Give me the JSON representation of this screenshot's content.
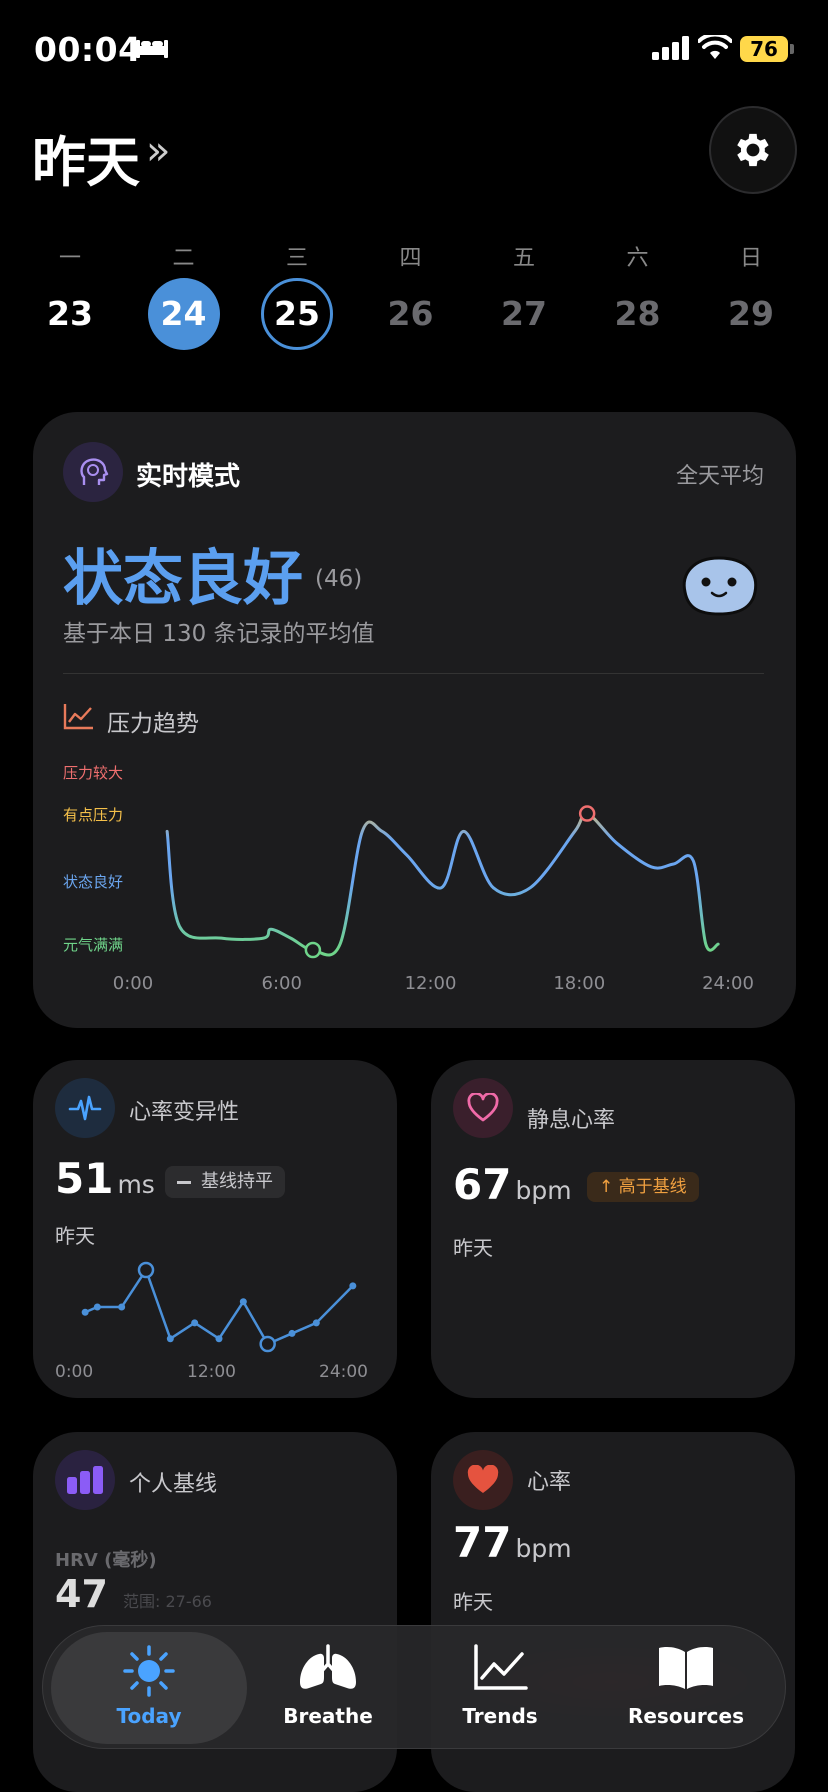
{
  "status_bar": {
    "time": "00:04",
    "battery": "76"
  },
  "header": {
    "title": "昨天",
    "arrow": "»"
  },
  "week": [
    {
      "label": "一",
      "day": "23",
      "state": "normal"
    },
    {
      "label": "二",
      "day": "24",
      "state": "selected"
    },
    {
      "label": "三",
      "day": "25",
      "state": "today"
    },
    {
      "label": "四",
      "day": "26",
      "state": "future"
    },
    {
      "label": "五",
      "day": "27",
      "state": "future"
    },
    {
      "label": "六",
      "day": "28",
      "state": "future"
    },
    {
      "label": "日",
      "day": "29",
      "state": "future"
    }
  ],
  "main_card": {
    "mode": "实时模式",
    "range": "全天平均",
    "state": "状态良好",
    "score": "(46)",
    "description": "基于本日 130 条记录的平均值",
    "trend_title": "压力趋势",
    "levels": [
      "压力较大",
      "有点压力",
      "状态良好",
      "元气满满"
    ]
  },
  "chart_data": [
    {
      "type": "line",
      "title": "压力趋势",
      "x_ticks": [
        "0:00",
        "6:00",
        "12:00",
        "18:00",
        "24:00"
      ],
      "y_categories": [
        "元气满满",
        "状态良好",
        "有点压力",
        "压力较大"
      ],
      "x_unit": "hour",
      "ylim": [
        0,
        3
      ],
      "series": [
        {
          "points": [
            [
              1.3,
              2
            ],
            [
              1.8,
              0.4
            ],
            [
              3.5,
              0.2
            ],
            [
              5.2,
              0.2
            ],
            [
              5.5,
              0.35
            ],
            [
              6.3,
              0.2
            ],
            [
              7.2,
              0
            ],
            [
              8.3,
              0.1
            ],
            [
              9.2,
              2
            ],
            [
              10,
              2
            ],
            [
              11,
              1.6
            ],
            [
              12.4,
              1.05
            ],
            [
              13.3,
              2
            ],
            [
              14.5,
              1.05
            ],
            [
              16,
              1.05
            ],
            [
              17.8,
              2
            ],
            [
              18.3,
              2.3
            ],
            [
              19.5,
              1.8
            ],
            [
              20.9,
              1.4
            ],
            [
              21.8,
              1.45
            ],
            [
              22.6,
              1.5
            ],
            [
              23.1,
              0.1
            ],
            [
              23.6,
              0.1
            ]
          ]
        }
      ],
      "markers": [
        [
          7.2,
          0
        ],
        [
          18.3,
          2.3
        ]
      ]
    },
    {
      "type": "line",
      "title": "心率变异性",
      "x_ticks": [
        "0:00",
        "12:00",
        "24:00"
      ],
      "x_unit": "hour",
      "series": [
        {
          "unit": "ms",
          "points": [
            [
              1,
              51
            ],
            [
              2,
              52
            ],
            [
              4,
              52
            ],
            [
              6,
              59
            ],
            [
              8,
              46
            ],
            [
              10,
              49
            ],
            [
              12,
              46
            ],
            [
              14,
              53
            ],
            [
              16,
              45
            ],
            [
              18,
              47
            ],
            [
              20,
              49
            ],
            [
              23,
              56
            ]
          ]
        }
      ],
      "markers": [
        [
          6,
          59
        ],
        [
          16,
          45
        ]
      ]
    }
  ],
  "hrv_card": {
    "title": "心率变异性",
    "value": "51",
    "unit": "ms",
    "badge": "基线持平",
    "sub": "昨天"
  },
  "rhr_card": {
    "title": "静息心率",
    "value": "67",
    "unit": "bpm",
    "badge": "高于基线",
    "sub": "昨天"
  },
  "baseline_card": {
    "title": "个人基线",
    "metric": "HRV (毫秒)",
    "value": "47",
    "range": "范围: 27-66"
  },
  "hr_card": {
    "title": "心率",
    "value": "77",
    "unit": "bpm",
    "sub": "昨天"
  },
  "tabbar": {
    "tabs": [
      {
        "label": "Today",
        "icon": "sun-icon",
        "active": true
      },
      {
        "label": "Breathe",
        "icon": "lungs-icon",
        "active": false
      },
      {
        "label": "Trends",
        "icon": "trend-chart-icon",
        "active": false
      },
      {
        "label": "Resources",
        "icon": "book-icon",
        "active": false
      }
    ]
  },
  "colors": {
    "accent": "#4a90d9",
    "state_good": "#5b9ff0",
    "pressure_high": "#ef6f6f",
    "pressure_some": "#f5c04a",
    "energetic": "#6fd48a",
    "rhr_up": "#f0a040"
  }
}
